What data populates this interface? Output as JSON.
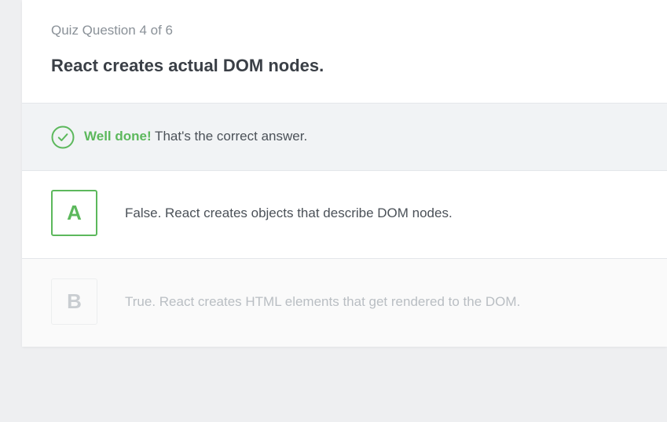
{
  "quiz": {
    "question_count": "Quiz Question 4 of 6",
    "question_text": "React creates actual DOM nodes."
  },
  "feedback": {
    "icon": "check-circle-icon",
    "strong": "Well done!",
    "message": " That's the correct answer.",
    "color": "#5cb85c"
  },
  "answers": [
    {
      "letter": "A",
      "text": "False. React creates objects that describe DOM nodes.",
      "state": "correct"
    },
    {
      "letter": "B",
      "text": "True. React creates HTML elements that get rendered to the DOM.",
      "state": "disabled"
    }
  ]
}
